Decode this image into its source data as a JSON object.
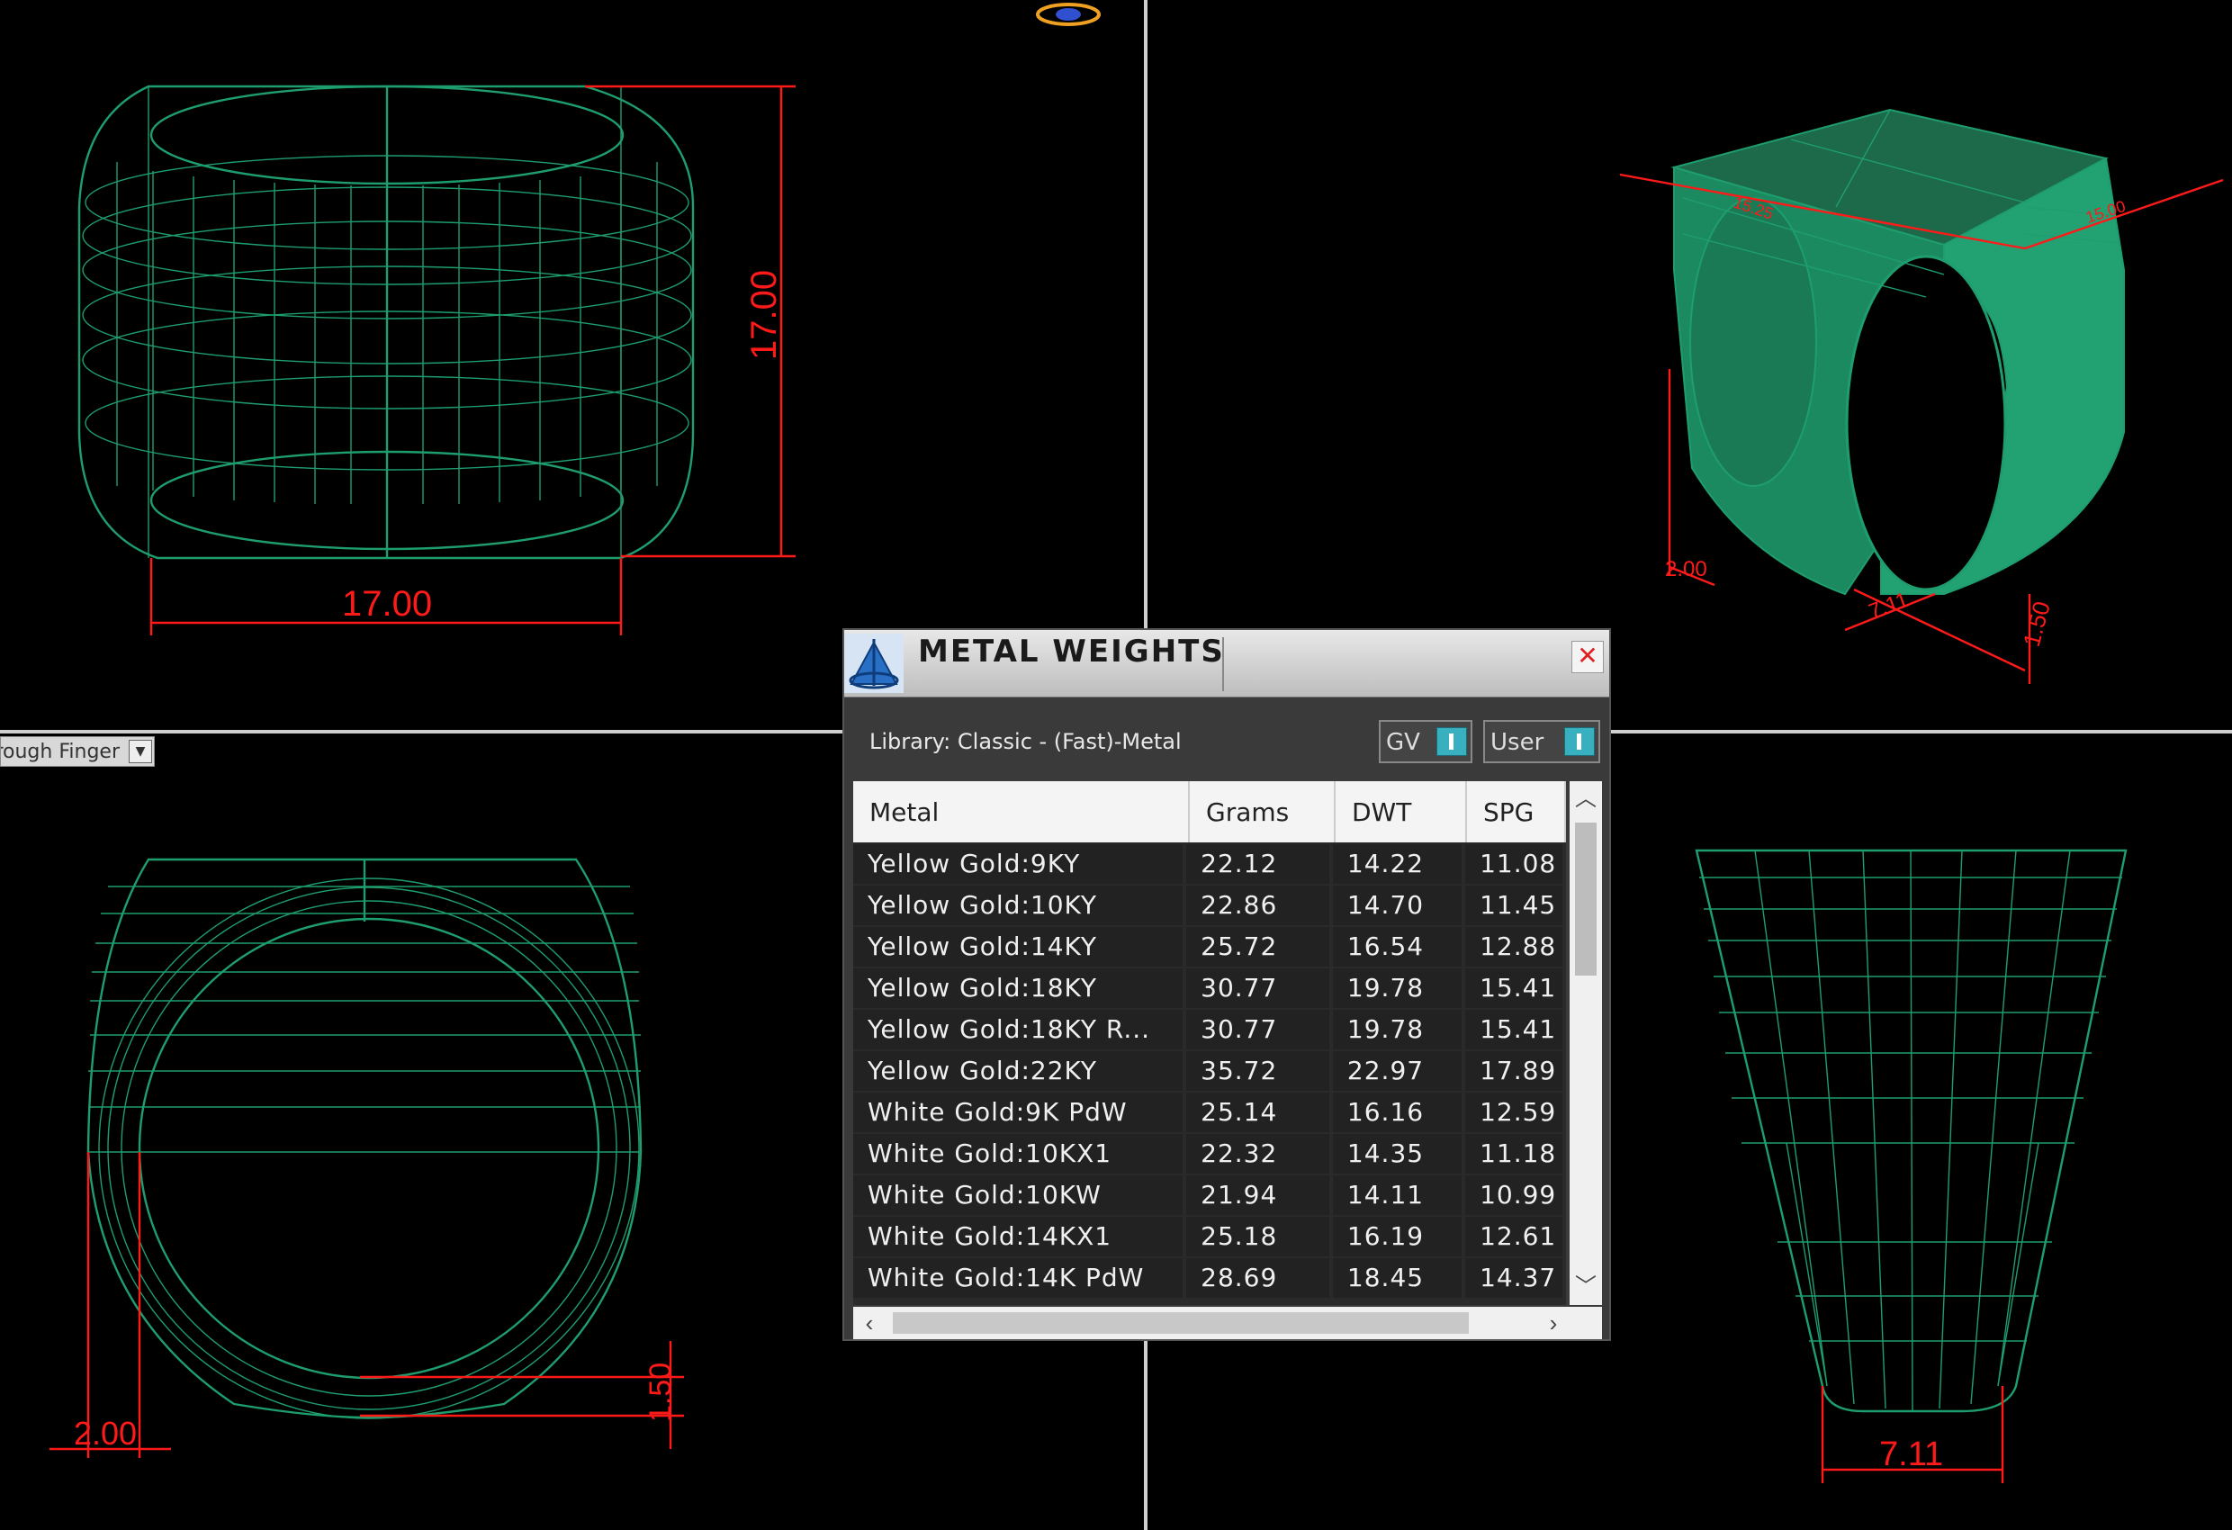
{
  "viewport_labels": {
    "front_width": "17.00",
    "front_height": "17.00",
    "persp_top_left": "15.25",
    "persp_top_right": "15.00",
    "persp_bottom_left": "2.00",
    "persp_bottom_mid": "7.11",
    "persp_bottom_right": "1.50",
    "side_left": "2.00",
    "side_right": "1.50",
    "top_bottom": "7.11"
  },
  "dropdown": {
    "label": "rough Finger"
  },
  "panel": {
    "title": "METAL WEIGHTS",
    "library": "Library: Classic - (Fast)-Metal",
    "toggle_gv": "GV",
    "toggle_user": "User",
    "close_glyph": "✕",
    "columns": [
      "Metal",
      "Grams",
      "DWT",
      "SPG"
    ],
    "rows": [
      {
        "metal": "Yellow Gold:9KY",
        "grams": "22.12",
        "dwt": "14.22",
        "spg": "11.08"
      },
      {
        "metal": "Yellow Gold:10KY",
        "grams": "22.86",
        "dwt": "14.70",
        "spg": "11.45"
      },
      {
        "metal": "Yellow Gold:14KY",
        "grams": "25.72",
        "dwt": "16.54",
        "spg": "12.88"
      },
      {
        "metal": "Yellow Gold:18KY",
        "grams": "30.77",
        "dwt": "19.78",
        "spg": "15.41"
      },
      {
        "metal": "Yellow Gold:18KY R...",
        "grams": "30.77",
        "dwt": "19.78",
        "spg": "15.41"
      },
      {
        "metal": "Yellow Gold:22KY",
        "grams": "35.72",
        "dwt": "22.97",
        "spg": "17.89"
      },
      {
        "metal": "White Gold:9K PdW",
        "grams": "25.14",
        "dwt": "16.16",
        "spg": "12.59"
      },
      {
        "metal": "White Gold:10KX1",
        "grams": "22.32",
        "dwt": "14.35",
        "spg": "11.18"
      },
      {
        "metal": "White Gold:10KW",
        "grams": "21.94",
        "dwt": "14.11",
        "spg": "10.99"
      },
      {
        "metal": "White Gold:14KX1",
        "grams": "25.18",
        "dwt": "16.19",
        "spg": "12.61"
      },
      {
        "metal": "White Gold:14K PdW",
        "grams": "28.69",
        "dwt": "18.45",
        "spg": "14.37"
      }
    ]
  },
  "colors": {
    "wire": "#1e9e6e",
    "dimension": "#ff1a1a",
    "background": "#000000",
    "toggle": "#38b0c0"
  },
  "icons": [
    "compass-icon",
    "close-icon",
    "scroll-up-icon",
    "scroll-down-icon",
    "scroll-left-icon",
    "scroll-right-icon",
    "dropdown-arrow-icon",
    "ring-gizmo-icon"
  ]
}
